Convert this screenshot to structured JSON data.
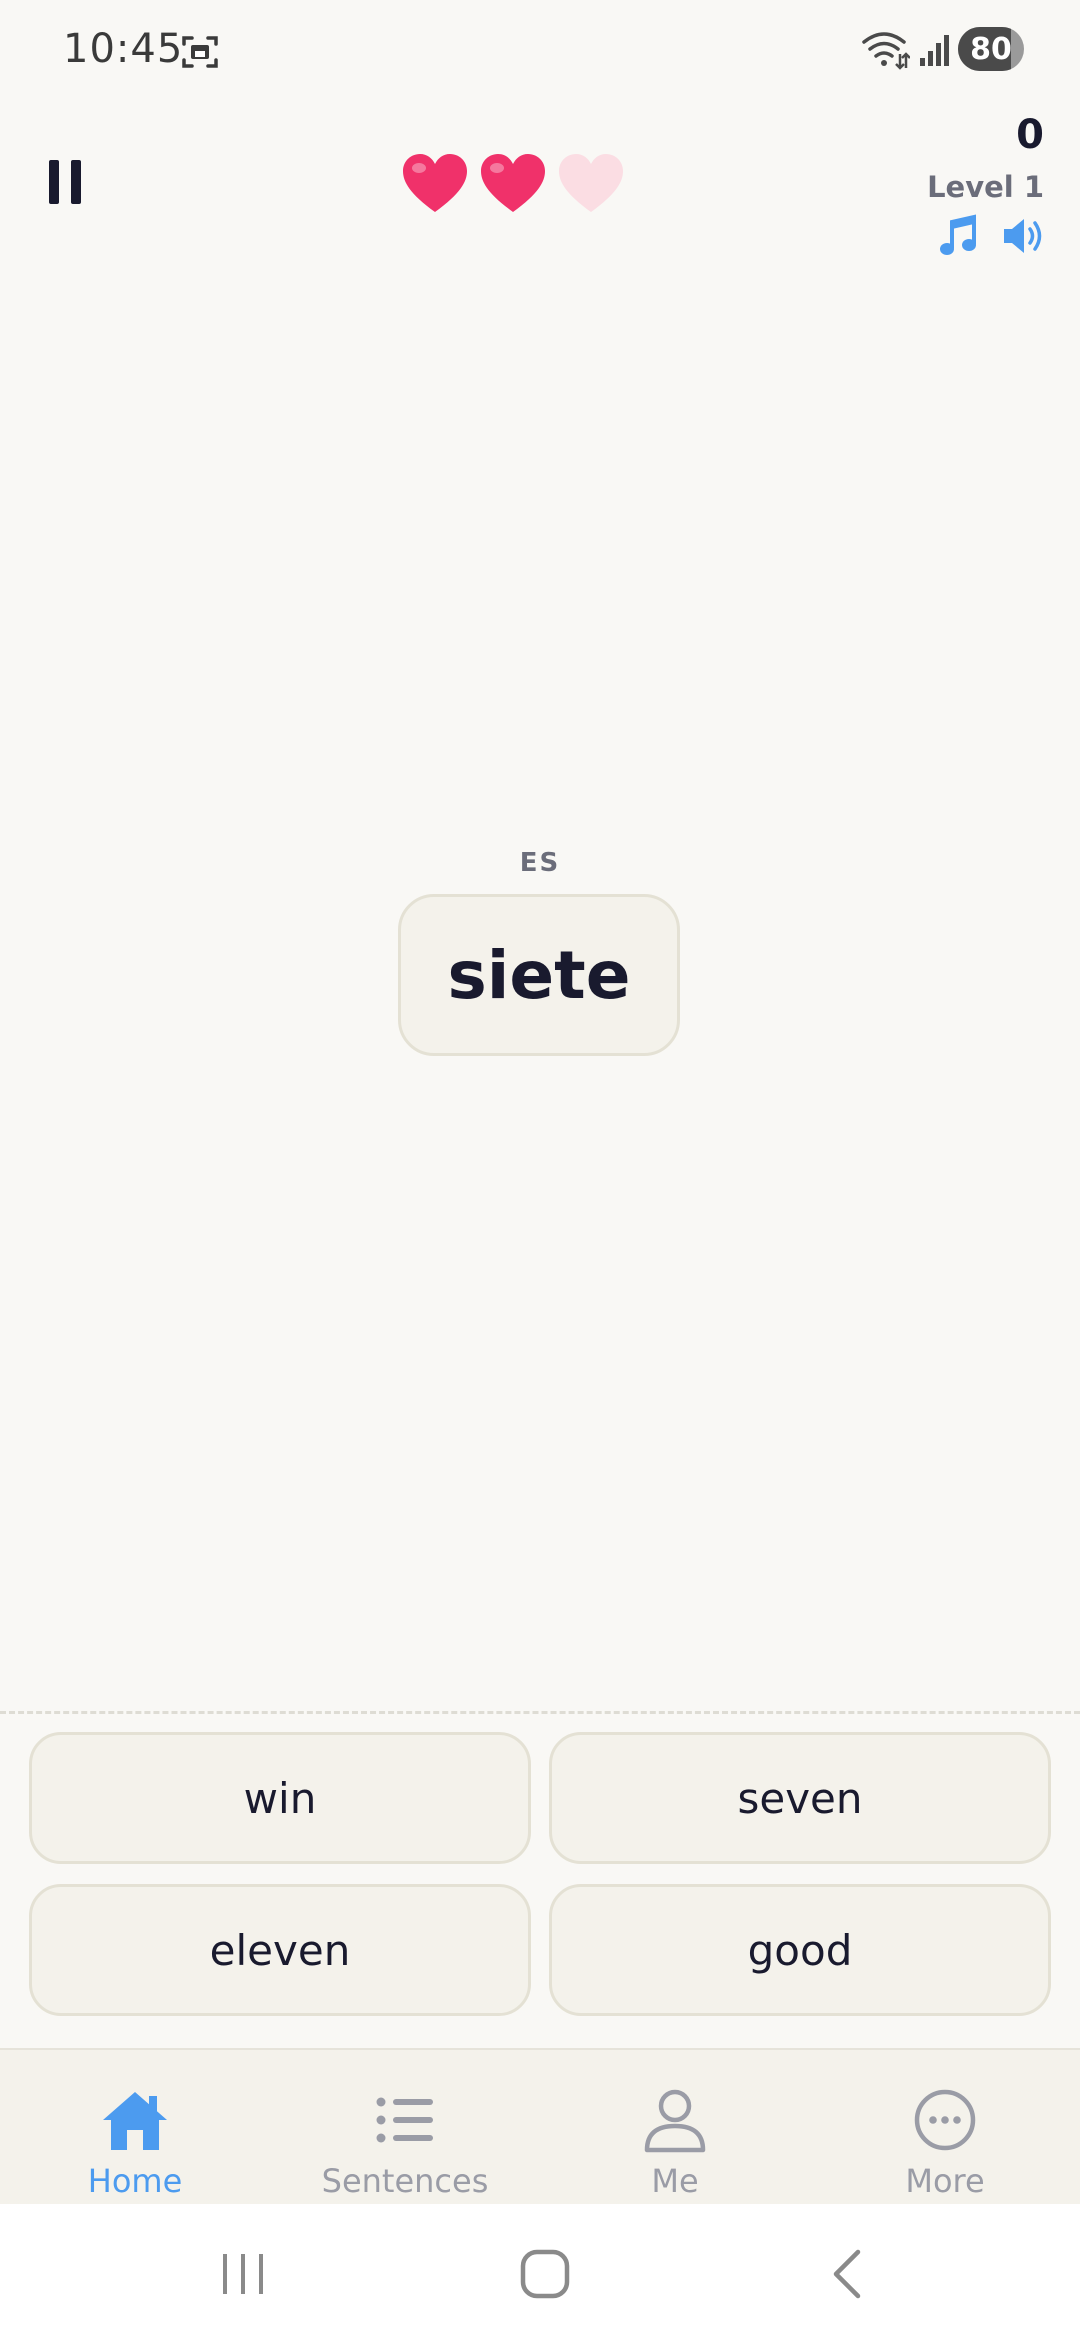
{
  "status_bar": {
    "time": "10:45",
    "battery": "80",
    "battery_level": 0.8,
    "icons": [
      "screenshot-icon",
      "wifi-icon",
      "signal-icon",
      "battery-icon"
    ]
  },
  "game": {
    "score": "0",
    "level": "Level 1",
    "hearts_total": 3,
    "hearts_remaining": 2,
    "heart_colors": {
      "full": "#F0316A",
      "empty": "#FBDDE3"
    },
    "accent": "#4C9BEF"
  },
  "card": {
    "language": "ES",
    "word": "siete"
  },
  "answers": [
    {
      "label": "win"
    },
    {
      "label": "seven"
    },
    {
      "label": "eleven"
    },
    {
      "label": "good"
    }
  ],
  "bottom_nav": {
    "items": [
      {
        "label": "Home",
        "icon": "home-icon",
        "active": true
      },
      {
        "label": "Sentences",
        "icon": "list-icon",
        "active": false
      },
      {
        "label": "Me",
        "icon": "person-icon",
        "active": false
      },
      {
        "label": "More",
        "icon": "more-icon",
        "active": false
      }
    ]
  },
  "system_nav": {
    "icons": [
      "recents-icon",
      "home-circle-icon",
      "back-icon"
    ]
  }
}
